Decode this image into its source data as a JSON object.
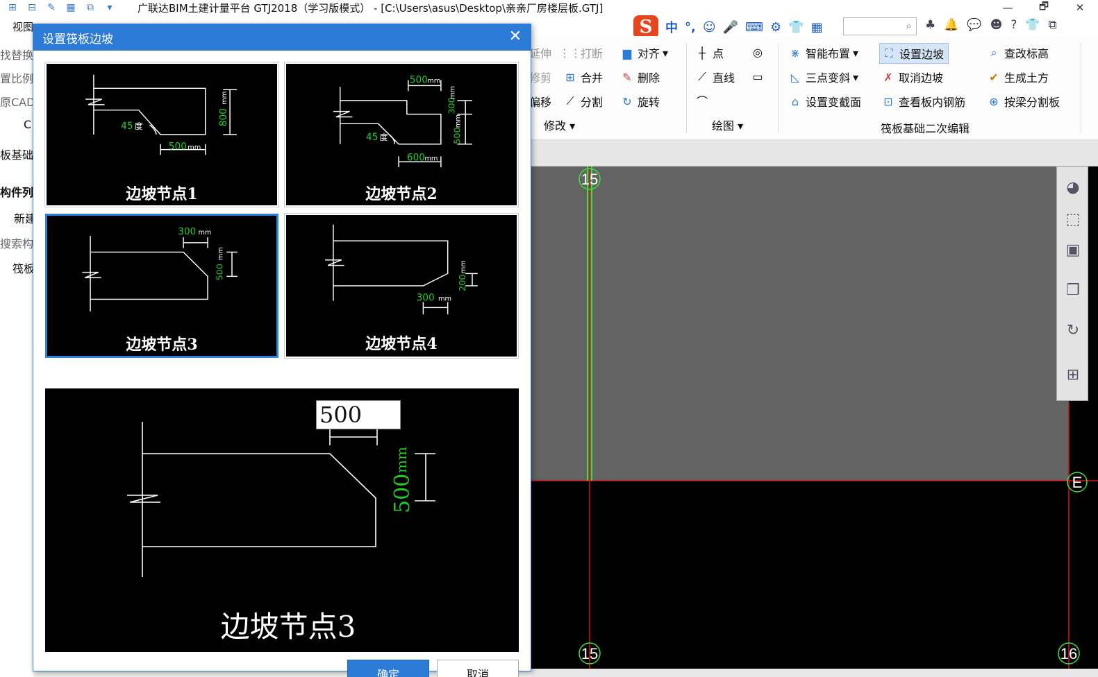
{
  "window": {
    "title": "广联达BIM土建计量平台 GTJ2018（学习版模式） - [C:\\Users\\asus\\Desktop\\亲亲厂房楼层板.GTJ]",
    "controls": [
      "—",
      "🗗",
      "✕"
    ]
  },
  "menu": {
    "view": "视图"
  },
  "ime": {
    "logo": "S",
    "items": [
      "中",
      "°,",
      "☺",
      "🎤",
      "⌨",
      "⚙",
      "👕",
      "▦"
    ]
  },
  "ribbon": {
    "modify": {
      "left_partial": [
        "延伸",
        "修剪",
        "偏移"
      ],
      "break": "打断",
      "merge": "合并",
      "split": "分割",
      "align": "对齐",
      "delete": "删除",
      "rotate": "旋转",
      "label": "修改"
    },
    "draw": {
      "point": "点",
      "line": "直线",
      "label": "绘图"
    },
    "raft_edit": {
      "smart_layout": "智能布置",
      "three_point_slope": "三点变斜",
      "set_section": "设置变截面",
      "set_slope": "设置边坡",
      "cancel_slope": "取消边坡",
      "view_rebar": "查看板内钢筋",
      "check_elevation": "查改标高",
      "gen_earthwork": "生成土方",
      "split_by_beam": "按梁分割板",
      "label": "筏板基础二次编辑"
    }
  },
  "left_panel": {
    "items": [
      "找替换",
      "置比例",
      "原CAD",
      "C",
      "板基础",
      "构件列",
      "新建",
      "搜索构",
      "筏板"
    ]
  },
  "canvas": {
    "axis_labels": {
      "top_15": "15",
      "bottom_15": "15",
      "bottom_16": "16",
      "right_E": "E"
    }
  },
  "dialog": {
    "title": "设置筏板边坡",
    "close": "✕",
    "nodes": [
      {
        "label": "边坡节点1",
        "dims": [
          "500",
          "mm",
          "800",
          "mm",
          "45",
          "度"
        ]
      },
      {
        "label": "边坡节点2",
        "dims": [
          "500",
          "mm",
          "300",
          "mm",
          "500",
          "mm",
          "600",
          "mm",
          "45",
          "度"
        ]
      },
      {
        "label": "边坡节点3",
        "dims": [
          "300",
          "mm",
          "500",
          "mm"
        ]
      },
      {
        "label": "边坡节点4",
        "dims": [
          "300",
          "mm",
          "200",
          "mm"
        ]
      }
    ],
    "selected_node": 3,
    "preview": {
      "label": "边坡节点3",
      "input_value": "500",
      "vertical_dim": "500",
      "vertical_unit": "mm"
    },
    "ok": "确定",
    "cancel": "取消"
  },
  "colors": {
    "accent": "#2c7bd6",
    "dim_green": "#22cc22",
    "axis_red": "#d01818"
  }
}
